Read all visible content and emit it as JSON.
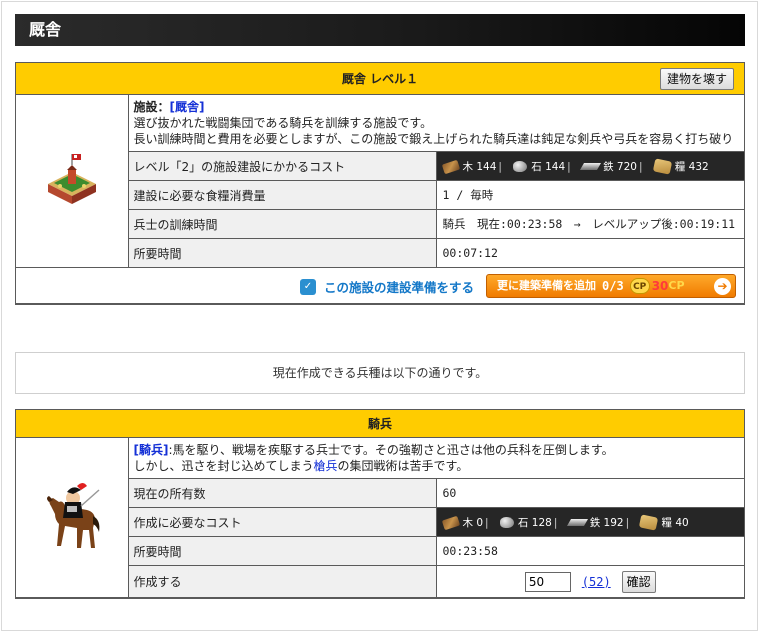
{
  "page": {
    "title": "厩舎"
  },
  "building": {
    "header": "厩舎 レベル１",
    "destroy_label": "建物を壊す",
    "facility_prefix": "施設：",
    "facility_name": "[厩舎]",
    "description_1": "選び抜かれた戦闘集団である騎兵を訓練する施設です。",
    "description_2": "長い訓練時間と費用を必要としますが、この施設で鍛え上げられた騎兵達は鈍足な剣兵や弓兵を容易く打ち破り",
    "rows": {
      "cost_label": "レベル「2」の施設建設にかかるコスト",
      "food_label": "建設に必要な食糧消費量",
      "food_value": "1 / 毎時",
      "train_label": "兵士の訓練時間",
      "train_value": "騎兵　現在:00:23:58　→　レベルアップ後:00:19:11",
      "time_label": "所要時間",
      "time_value": "00:07:12"
    },
    "cost": {
      "wood": "木 144",
      "stone": "石 144",
      "iron": "鉄 720",
      "rice": "糧 432"
    },
    "prep_link": "この施設の建設準備をする",
    "prep_button": {
      "label": "更に建築準備を追加",
      "ratio": "0/3",
      "cp_badge": "CP",
      "cp_amount": "30",
      "cp_unit": "CP"
    }
  },
  "info_text": "現在作成できる兵種は以下の通りです。",
  "unit": {
    "header": "騎兵",
    "name_tag": "[騎兵]",
    "desc_1": ":馬を駆り、戦場を疾駆する兵士です。その強靭さと迅さは他の兵科を圧倒します。",
    "desc_2a": "しかし、迅さを封じ込めてしまう",
    "desc_2_link": "槍兵",
    "desc_2b": "の集団戦術は苦手です。",
    "rows": {
      "owned_label": "現在の所有数",
      "owned_value": "60",
      "cost_label": "作成に必要なコスト",
      "time_label": "所要時間",
      "time_value": "00:23:58",
      "create_label": "作成する"
    },
    "cost": {
      "wood": "木 0",
      "stone": "石 128",
      "iron": "鉄 192",
      "rice": "糧 40"
    },
    "qty_value": "50",
    "max_label": "(52)",
    "confirm_label": "確認"
  },
  "colors": {
    "accent_yellow": "#ffcc00",
    "header_dark": "#1a1a1a",
    "link_blue": "#1430d6",
    "orange": "#f07b00"
  }
}
